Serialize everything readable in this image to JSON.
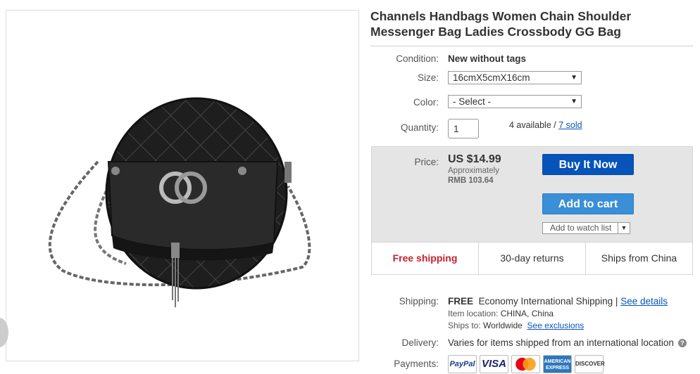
{
  "product": {
    "title": "Channels Handbags Women Chain Shoulder Messenger Bag Ladies Crossbody GG Bag",
    "image_icon": "black-quilted-round-crossbody-bag-image"
  },
  "condition": {
    "label": "Condition:",
    "value": "New without tags"
  },
  "size": {
    "label": "Size:",
    "value": "16cmX5cmX16cm"
  },
  "color": {
    "label": "Color:",
    "value": "- Select -"
  },
  "quantity": {
    "label": "Quantity:",
    "value": "1",
    "available": "4 available /",
    "sold": "7 sold"
  },
  "price": {
    "label": "Price:",
    "value": "US $14.99",
    "approx": "Approximately",
    "converted": "RMB 103.64"
  },
  "actions": {
    "buy_now": "Buy It Now",
    "add_to_cart": "Add to cart",
    "watch": "Add to watch list"
  },
  "features": [
    "Free shipping",
    "30-day returns",
    "Ships from China"
  ],
  "shipping": {
    "label": "Shipping:",
    "free": "FREE",
    "method": "Economy International Shipping |",
    "details_link": "See details",
    "location_label": "Item location:",
    "location": "CHINA, China",
    "ships_to_label": "Ships to:",
    "ships_to": "Worldwide",
    "exclusions_link": "See exclusions"
  },
  "delivery": {
    "label": "Delivery:",
    "value": "Varies for items shipped from an international location"
  },
  "payments": {
    "label": "Payments:",
    "methods": [
      "PayPal",
      "VISA",
      "MasterCard",
      "AMERICAN EXPRESS",
      "DISCOVER"
    ]
  },
  "colors": {
    "link": "#0654ba",
    "buy": "#0654ba",
    "cart": "#3a8fd6",
    "free_shipping": "#c5202e"
  }
}
